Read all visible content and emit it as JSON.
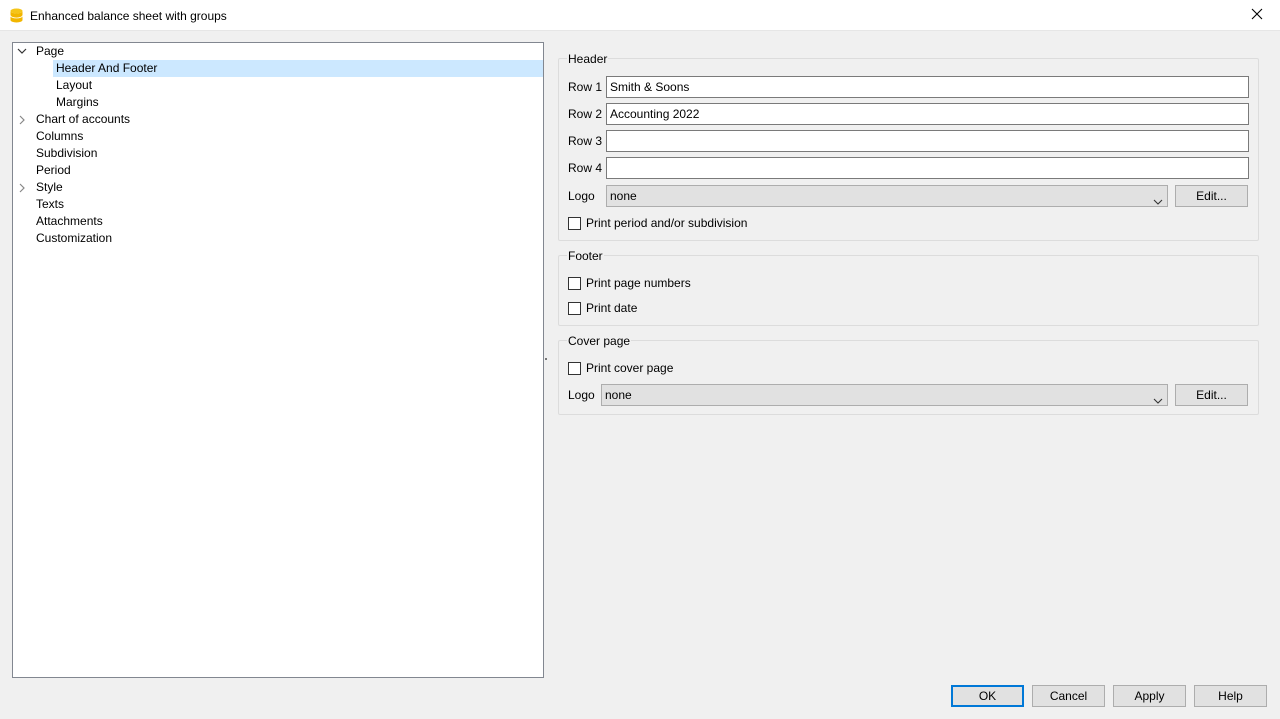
{
  "window": {
    "title": "Enhanced balance sheet with groups",
    "close_icon": "close-icon",
    "app_icon": "database-icon"
  },
  "tree": {
    "items": [
      {
        "label": "Page",
        "level": 0,
        "expander": "expanded",
        "selected": false
      },
      {
        "label": "Header And Footer",
        "level": 1,
        "expander": "none",
        "selected": true
      },
      {
        "label": "Layout",
        "level": 1,
        "expander": "none",
        "selected": false
      },
      {
        "label": "Margins",
        "level": 1,
        "expander": "none",
        "selected": false
      },
      {
        "label": "Chart of accounts",
        "level": 0,
        "expander": "collapsed",
        "selected": false
      },
      {
        "label": "Columns",
        "level": 0,
        "expander": "none",
        "selected": false
      },
      {
        "label": "Subdivision",
        "level": 0,
        "expander": "none",
        "selected": false
      },
      {
        "label": "Period",
        "level": 0,
        "expander": "none",
        "selected": false
      },
      {
        "label": "Style",
        "level": 0,
        "expander": "collapsed",
        "selected": false
      },
      {
        "label": "Texts",
        "level": 0,
        "expander": "none",
        "selected": false
      },
      {
        "label": "Attachments",
        "level": 0,
        "expander": "none",
        "selected": false
      },
      {
        "label": "Customization",
        "level": 0,
        "expander": "none",
        "selected": false
      }
    ]
  },
  "header": {
    "title": "Header",
    "row1_label": "Row 1",
    "row1_value": "Smith & Soons",
    "row2_label": "Row 2",
    "row2_value": "Accounting 2022",
    "row3_label": "Row 3",
    "row3_value": "",
    "row4_label": "Row 4",
    "row4_value": "",
    "logo_label": "Logo",
    "logo_value": "none",
    "edit_label": "Edit...",
    "print_period_label": "Print period and/or subdivision",
    "print_period_checked": false
  },
  "footer": {
    "title": "Footer",
    "page_numbers_label": "Print page numbers",
    "page_numbers_checked": false,
    "date_label": "Print date",
    "date_checked": false
  },
  "cover": {
    "title": "Cover page",
    "print_cover_label": "Print cover page",
    "print_cover_checked": false,
    "logo_label": "Logo",
    "logo_value": "none",
    "edit_label": "Edit..."
  },
  "buttons": {
    "ok": "OK",
    "cancel": "Cancel",
    "apply": "Apply",
    "help": "Help"
  },
  "colors": {
    "selection": "#cce8ff",
    "focus_border": "#0078d7",
    "app_icon": "#f5c518"
  }
}
